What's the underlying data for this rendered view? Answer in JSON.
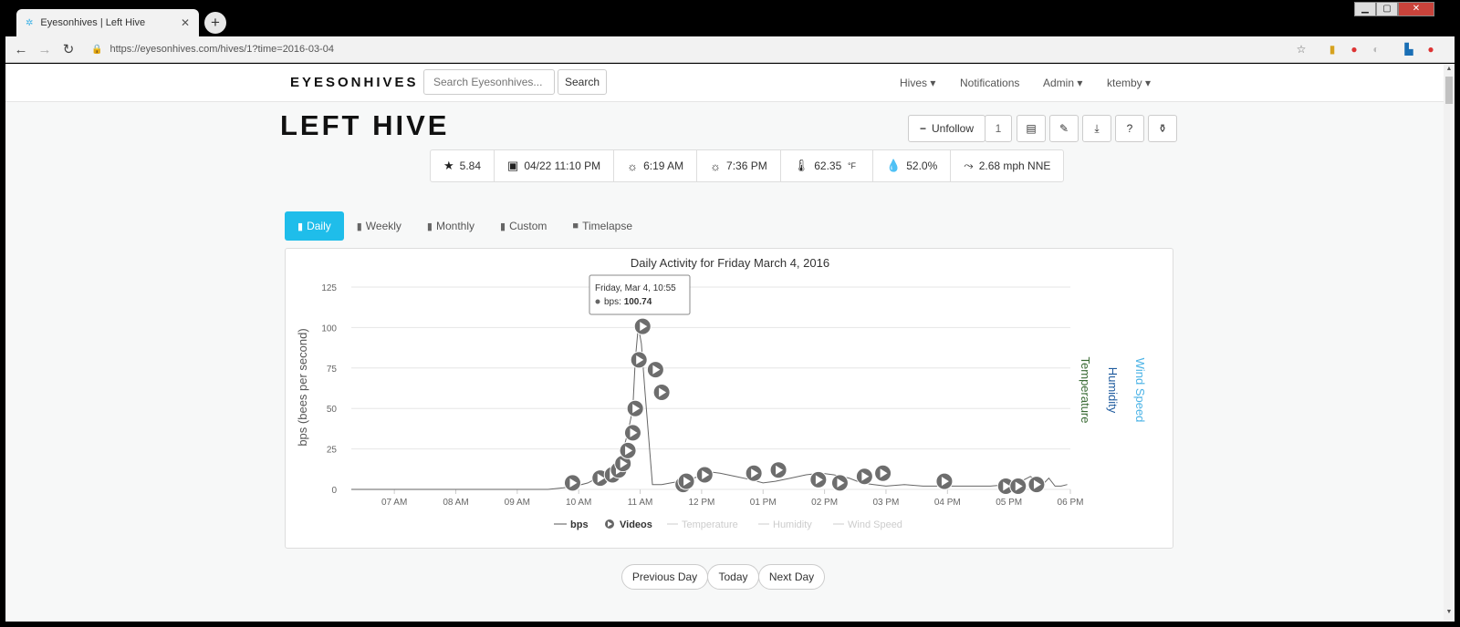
{
  "browser": {
    "tab_title": "Eyesonhives | Left Hive",
    "url": "https://eyesonhives.com/hives/1?time=2016-03-04"
  },
  "navbar": {
    "brand": "EYESONHIVES",
    "search_placeholder": "Search Eyesonhives...",
    "search_button": "Search",
    "links": [
      "Hives",
      "Notifications",
      "Admin",
      "ktemby"
    ]
  },
  "hive": {
    "title": "LEFT HIVE",
    "unfollow_label": "Unfollow",
    "follower_count": "1"
  },
  "stats": [
    {
      "icon": "star-icon",
      "value": "5.84"
    },
    {
      "icon": "calendar-icon",
      "value": "04/22 11:10 PM"
    },
    {
      "icon": "sunrise-icon",
      "value": "6:19 AM"
    },
    {
      "icon": "sunset-icon",
      "value": "7:36 PM"
    },
    {
      "icon": "thermometer-icon",
      "value": "62.35",
      "unit": "°F"
    },
    {
      "icon": "humidity-icon",
      "value": "52.0%"
    },
    {
      "icon": "wind-icon",
      "value": "2.68 mph NNE"
    }
  ],
  "view_tabs": [
    "Daily",
    "Weekly",
    "Monthly",
    "Custom",
    "Timelapse"
  ],
  "active_tab": "Daily",
  "pager": {
    "previous": "Previous Day",
    "today": "Today",
    "next": "Next Day"
  },
  "colors": {
    "accent": "#1fbdea",
    "temperature": "#3a6b35",
    "humidity": "#1f5b9e",
    "wind": "#4bb3e6"
  },
  "chart_data": {
    "type": "line",
    "title": "Daily Activity for Friday March 4, 2016",
    "ylabel": "bps (bees per second)",
    "right_axis_labels": [
      "Temperature",
      "Humidity",
      "Wind Speed"
    ],
    "ylim": [
      0,
      125
    ],
    "yticks": [
      0,
      25,
      50,
      75,
      100,
      125
    ],
    "x_ticks": [
      "07 AM",
      "08 AM",
      "09 AM",
      "10 AM",
      "11 AM",
      "12 PM",
      "01 PM",
      "02 PM",
      "03 PM",
      "04 PM",
      "05 PM",
      "06 PM"
    ],
    "x_range_hours": [
      6.3,
      18
    ],
    "series": [
      {
        "name": "bps",
        "x_hours": [
          6.3,
          9.5,
          9.75,
          9.95,
          10.15,
          10.3,
          10.45,
          10.55,
          10.65,
          10.72,
          10.8,
          10.88,
          10.92,
          10.97,
          11.02,
          11.08,
          11.2,
          11.35,
          11.5,
          11.65,
          11.8,
          11.95,
          12.1,
          12.3,
          12.55,
          12.8,
          13.0,
          13.2,
          13.45,
          13.7,
          13.95,
          14.15,
          14.4,
          14.6,
          14.8,
          15.0,
          15.3,
          15.6,
          15.9,
          16.3,
          16.7,
          17.0,
          17.2,
          17.35,
          17.55,
          17.65,
          17.75,
          17.85,
          17.95
        ],
        "values": [
          0,
          0,
          1,
          2,
          4,
          7,
          10,
          12,
          16,
          24,
          35,
          50,
          80,
          100.74,
          90,
          60,
          3,
          3,
          4,
          5,
          6,
          8,
          11,
          10,
          8,
          6,
          4,
          5,
          7,
          9,
          10,
          9,
          7,
          4,
          3,
          2,
          3,
          2,
          2,
          2,
          2,
          3,
          5,
          8,
          3,
          7,
          2,
          2,
          3
        ]
      },
      {
        "name": "Videos",
        "x_hours": [
          9.9,
          10.35,
          10.55,
          10.65,
          10.72,
          10.8,
          10.88,
          10.92,
          10.98,
          11.04,
          11.25,
          11.35,
          11.7,
          11.75,
          12.05,
          12.85,
          13.25,
          13.9,
          14.25,
          14.65,
          14.95,
          15.95,
          16.95,
          17.15,
          17.45
        ],
        "values": [
          4,
          7,
          9,
          12,
          16,
          24,
          35,
          50,
          80,
          100.74,
          74,
          60,
          3,
          5,
          9,
          10,
          12,
          6,
          4,
          8,
          10,
          5,
          2,
          2,
          3
        ]
      }
    ],
    "legend": [
      "bps",
      "Videos",
      "Temperature",
      "Humidity",
      "Wind Speed"
    ],
    "legend_position": "bottom",
    "tooltip": {
      "title": "Friday, Mar 4, 10:55",
      "label": "bps:",
      "value": "100.74"
    }
  }
}
